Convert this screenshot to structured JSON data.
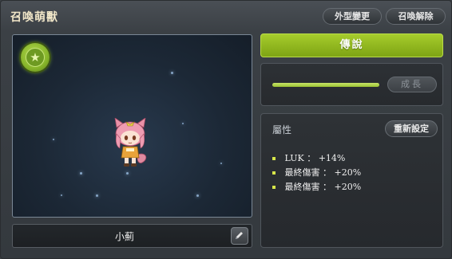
{
  "window": {
    "title": "召喚萌獸",
    "buttons": {
      "appearance": "外型變更",
      "dismiss": "召喚解除"
    }
  },
  "pet": {
    "name": "小薊",
    "grade_icon": "star-icon",
    "edit_icon": "pencil-icon"
  },
  "grade": {
    "label": "傳說"
  },
  "growth": {
    "button": "成長",
    "progress": 1.0
  },
  "stats": {
    "title": "屬性",
    "reset_button": "重新設定",
    "lines": [
      {
        "name": "LUK",
        "sep": "：",
        "value": "+14%"
      },
      {
        "name": "最終傷害",
        "sep": "：",
        "value": "+20%"
      },
      {
        "name": "最終傷害",
        "sep": "：",
        "value": "+20%"
      }
    ]
  },
  "colors": {
    "accent_green": "#8db51f",
    "stat_bullet": "#d7e64a"
  }
}
